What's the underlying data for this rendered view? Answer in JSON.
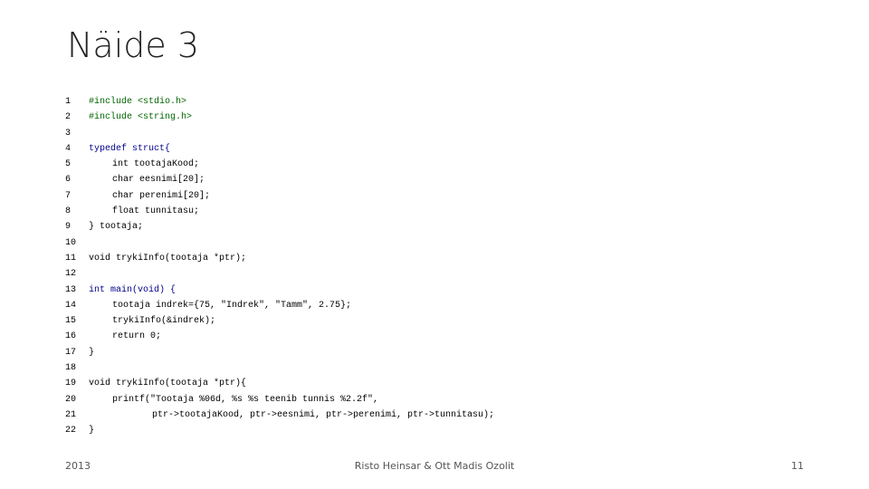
{
  "slide": {
    "title": "Näide 3"
  },
  "code": {
    "lines": [
      {
        "n": "1",
        "text": "#include <stdio.h>"
      },
      {
        "n": "2",
        "text": "#include <string.h>"
      },
      {
        "n": "3",
        "text": ""
      },
      {
        "n": "4",
        "text": "typedef struct{"
      },
      {
        "n": "5",
        "text": "int tootajaKood;"
      },
      {
        "n": "6",
        "text": "char eesnimi[20];"
      },
      {
        "n": "7",
        "text": "char perenimi[20];"
      },
      {
        "n": "8",
        "text": "float tunnitasu;"
      },
      {
        "n": "9",
        "text": "} tootaja;"
      },
      {
        "n": "10",
        "text": ""
      },
      {
        "n": "11",
        "text": "void trykiInfo(tootaja *ptr);"
      },
      {
        "n": "12",
        "text": ""
      },
      {
        "n": "13",
        "text": "int main(void) {"
      },
      {
        "n": "14",
        "text": "tootaja indrek={75, \"Indrek\", \"Tamm\", 2.75};"
      },
      {
        "n": "15",
        "text": "trykiInfo(&indrek);"
      },
      {
        "n": "16",
        "text": "return 0;"
      },
      {
        "n": "17",
        "text": "}"
      },
      {
        "n": "18",
        "text": ""
      },
      {
        "n": "19",
        "text": "void trykiInfo(tootaja *ptr){"
      },
      {
        "n": "20",
        "text": "printf(\"Tootaja %06d, %s %s teenib tunnis %2.2f\","
      },
      {
        "n": "21",
        "text": "ptr->tootajaKood, ptr->eesnimi, ptr->perenimi, ptr->tunnitasu);"
      },
      {
        "n": "22",
        "text": "}"
      }
    ]
  },
  "footer": {
    "year": "2013",
    "authors": "Risto Heinsar & Ott Madis Ozolit",
    "page": "11"
  }
}
